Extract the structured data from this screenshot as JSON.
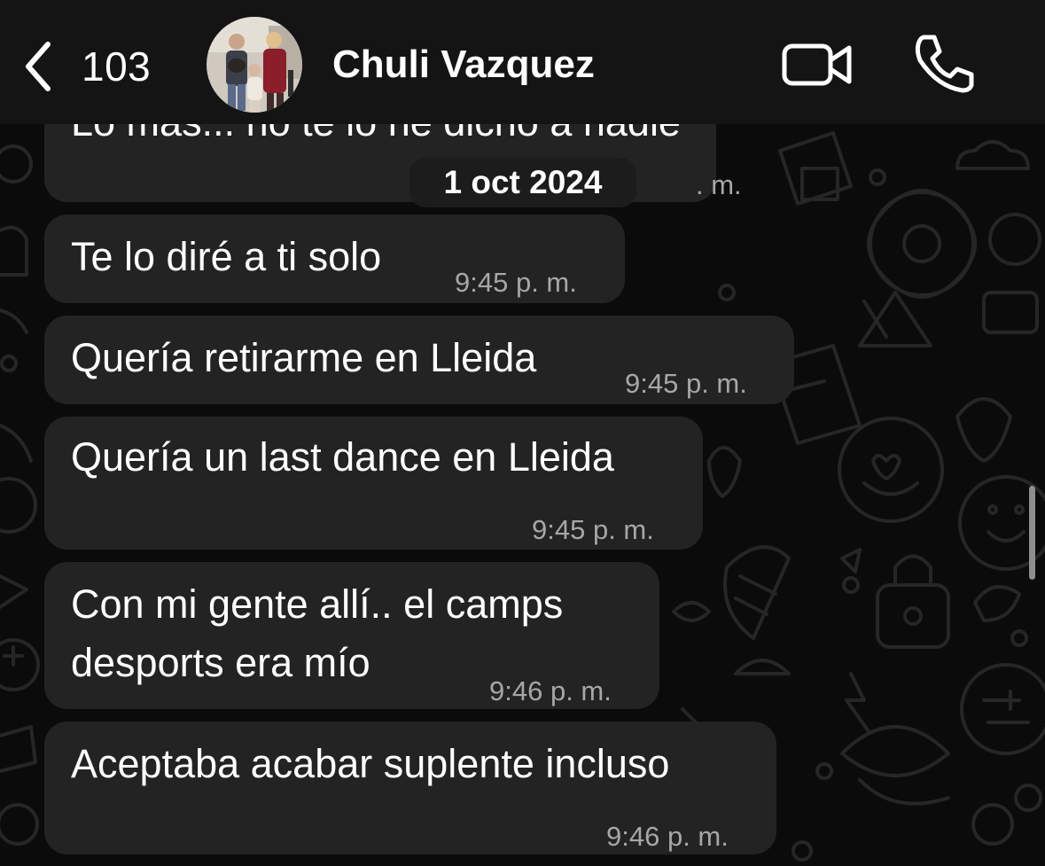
{
  "header": {
    "unread_count": "103",
    "contact_name": "Chuli Vazquez"
  },
  "date_separator": "1 oct 2024",
  "partial_message": {
    "text": "Lo mas... no te lo he dicho a nadie",
    "time": ". m."
  },
  "messages": [
    {
      "text_lines": [
        "Te lo diré a ti solo"
      ],
      "time": "9:45 p. m."
    },
    {
      "text_lines": [
        "Quería retirarme en Lleida"
      ],
      "time": "9:45 p. m."
    },
    {
      "text_lines": [
        "Quería un last dance en Lleida"
      ],
      "time": "9:45 p. m."
    },
    {
      "text_lines": [
        "Con mi gente allí.. el camps",
        "desports era mío"
      ],
      "time": "9:46 p. m."
    },
    {
      "text_lines": [
        "Aceptaba acabar suplente incluso"
      ],
      "time": "9:46 p. m."
    }
  ],
  "colors": {
    "background": "#0b0b0b",
    "header": "#141414",
    "bubble": "#232323",
    "timestamp": "#a7a7a7",
    "wallpaper_doodle": "#2a2a2a"
  },
  "icons": {
    "back": "chevron-left-icon",
    "video": "video-camera-icon",
    "call": "phone-icon"
  }
}
